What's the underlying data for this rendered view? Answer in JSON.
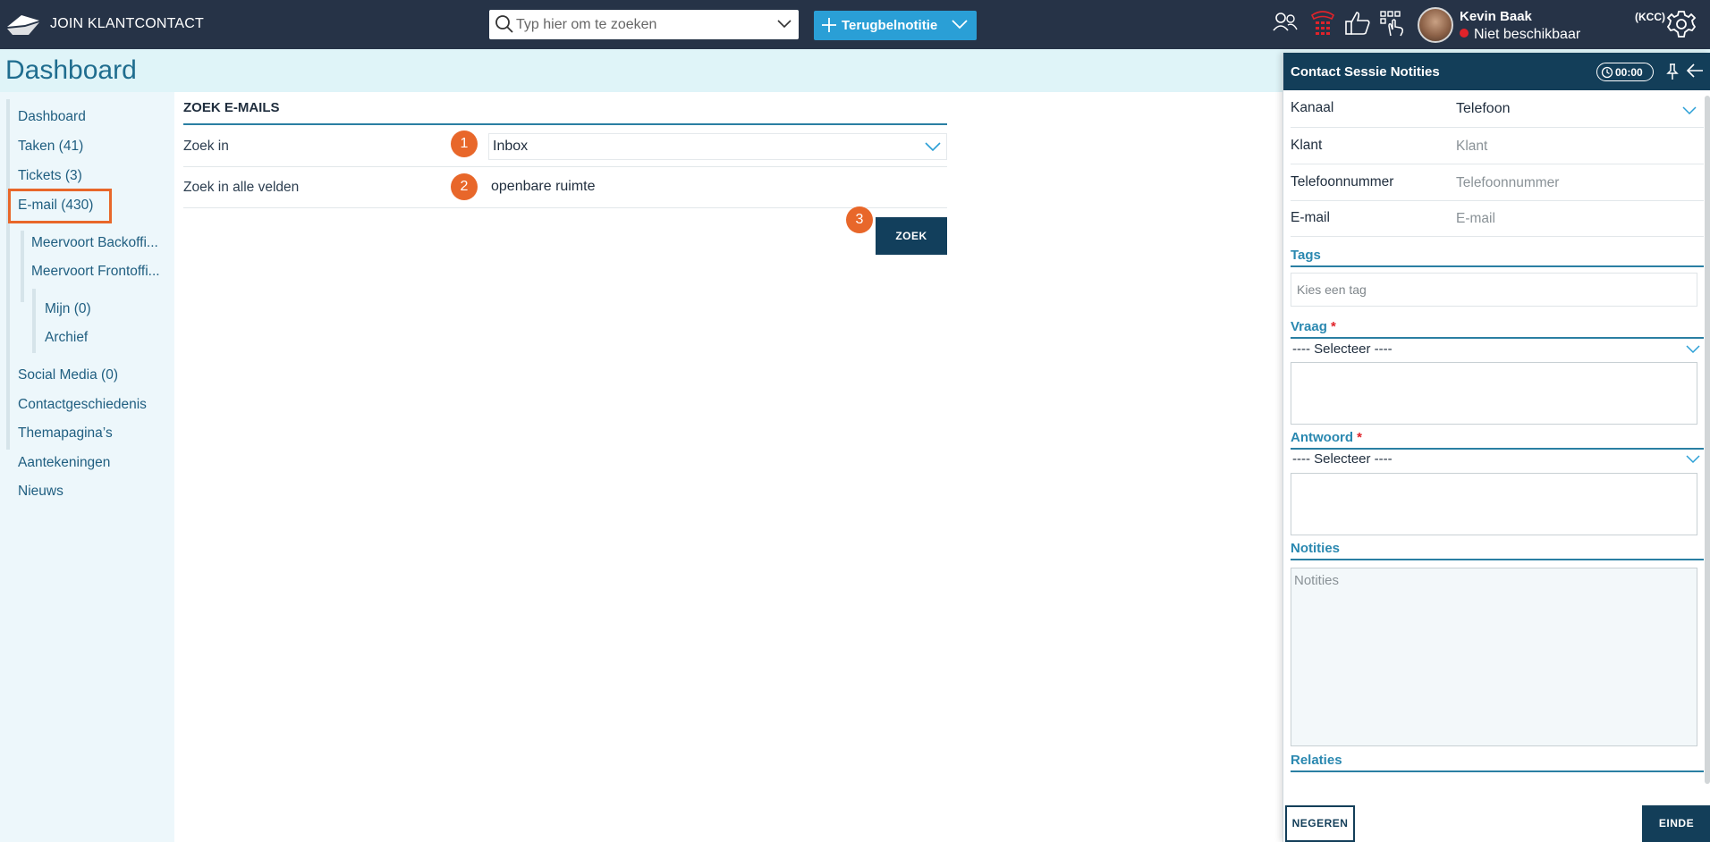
{
  "app": {
    "title": "JOIN KLANTCONTACT"
  },
  "search": {
    "placeholder": "Typ hier om te zoeken"
  },
  "toolbar": {
    "terug_label": "Terugbelnotitie"
  },
  "user": {
    "name": "Kevin Baak",
    "status": "Niet beschikbaar",
    "status_color": "#e0232a",
    "org": "(KCC)"
  },
  "page": {
    "title": "Dashboard"
  },
  "sidebar": {
    "items": [
      {
        "label": "Dashboard"
      },
      {
        "label": "Taken (41)"
      },
      {
        "label": "Tickets (3)"
      },
      {
        "label": "E-mail (430)"
      },
      {
        "label": "Meervoort Backoffi..."
      },
      {
        "label": "Meervoort Frontoffi..."
      },
      {
        "label": "Mijn (0)"
      },
      {
        "label": "Archief"
      },
      {
        "label": "Social Media (0)"
      },
      {
        "label": "Contactgeschiedenis"
      },
      {
        "label": "Themapagina’s"
      },
      {
        "label": "Aantekeningen"
      },
      {
        "label": "Nieuws"
      }
    ],
    "active_item": "E-mail (430)"
  },
  "email_search": {
    "title": "ZOEK E-MAILS",
    "zoek_in_label": "Zoek in",
    "zoek_in_value": "Inbox",
    "alle_velden_label": "Zoek in alle velden",
    "alle_velden_value": "openbare ruimte",
    "button_label": "ZOEK",
    "step_badges": [
      "1",
      "2",
      "3"
    ]
  },
  "panel": {
    "title": "Contact Sessie Notities",
    "timer": "00:00",
    "fields": {
      "kanaal_label": "Kanaal",
      "kanaal_value": "Telefoon",
      "klant_label": "Klant",
      "klant_placeholder": "Klant",
      "telefoon_label": "Telefoonnummer",
      "telefoon_placeholder": "Telefoonnummer",
      "email_label": "E-mail",
      "email_placeholder": "E-mail"
    },
    "tags": {
      "title": "Tags",
      "placeholder": "Kies een tag"
    },
    "vraag": {
      "title": "Vraag",
      "required": "*",
      "select": "---- Selecteer ----"
    },
    "antwoord": {
      "title": "Antwoord",
      "required": "*",
      "select": "---- Selecteer ----"
    },
    "notities": {
      "title": "Notities",
      "placeholder": "Notities"
    },
    "relaties": {
      "title": "Relaties"
    },
    "negeren_label": "NEGEREN",
    "einde_label": "EINDE"
  },
  "colors": {
    "topbar": "#263347",
    "accent": "#2a9fd6",
    "highlight": "#e8672a",
    "panel_header": "#133e59"
  }
}
